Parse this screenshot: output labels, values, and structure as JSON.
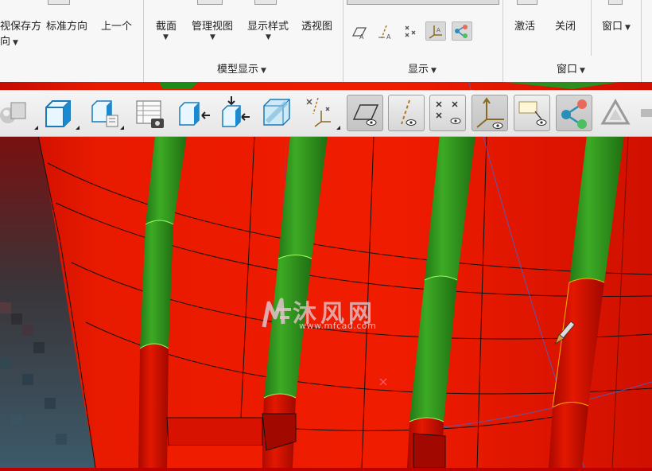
{
  "ribbon": {
    "view_group": {
      "save_orientation": "视保存方",
      "save_orientation_line2": "向",
      "standard_orientation": "标准方向",
      "previous": "上一个"
    },
    "model_display": {
      "section": "截面",
      "manage_views": "管理视图",
      "display_style": "显示样式",
      "perspective": "透视图",
      "group_label": "模型显示"
    },
    "show_group": {
      "group_label": "显示"
    },
    "window_group": {
      "activate": "激活",
      "close": "关闭",
      "window": "窗口",
      "group_label": "窗口"
    }
  },
  "toolbar": {
    "buttons": [
      "display-style-icon",
      "standard-orientation-icon",
      "saved-orientation-icon",
      "view-manager-icon",
      "previous-view-icon",
      "zoom-to-fit-icon",
      "section-view-icon",
      "datum-display-filter-icon",
      "plane-display-icon",
      "axis-display-icon",
      "point-display-icon",
      "csys-display-icon",
      "annotation-display-icon",
      "spin-center-icon",
      "model-render-icon"
    ]
  },
  "viewport": {
    "colors": {
      "surface": "#e81500",
      "surface_dark": "#b00a00",
      "rib": "#2f9e1f",
      "edge": "#111111"
    }
  },
  "watermark": {
    "brand_cn": "沐风网",
    "url": "www.mfcad.com"
  }
}
